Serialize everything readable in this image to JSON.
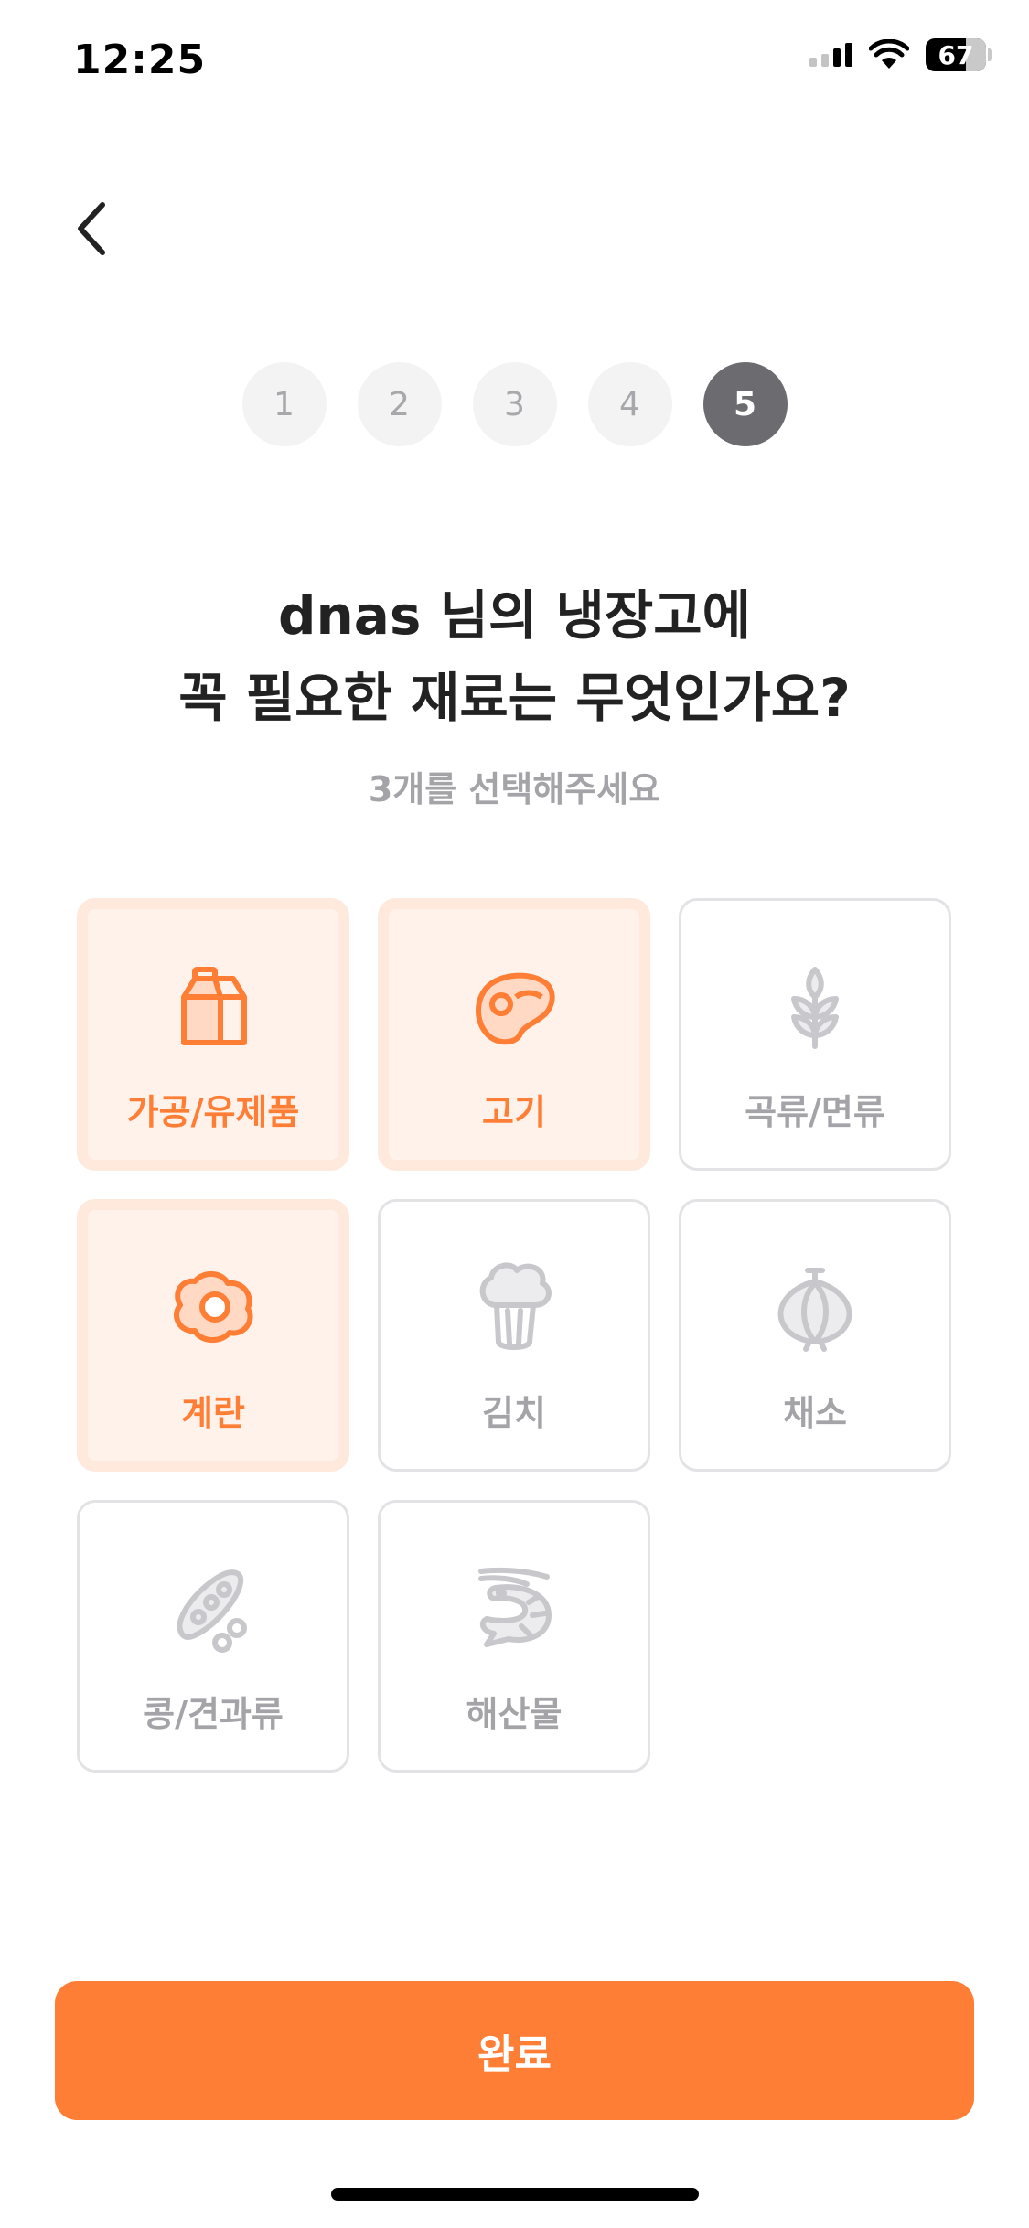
{
  "status_bar": {
    "time": "12:25",
    "battery": "67"
  },
  "steps": [
    "1",
    "2",
    "3",
    "4",
    "5"
  ],
  "current_step": "5",
  "title": {
    "line1": "dnas 님의 냉장고에",
    "line2": "꼭 필요한 재료는 무엇인가요?"
  },
  "subtitle": "3개를 선택해주세요",
  "categories": [
    {
      "label": "가공/유제품",
      "icon": "milk-carton-icon",
      "selected": true
    },
    {
      "label": "고기",
      "icon": "steak-icon",
      "selected": true
    },
    {
      "label": "곡류/면류",
      "icon": "wheat-icon",
      "selected": false
    },
    {
      "label": "계란",
      "icon": "fried-egg-icon",
      "selected": true
    },
    {
      "label": "김치",
      "icon": "cabbage-icon",
      "selected": false
    },
    {
      "label": "채소",
      "icon": "onion-icon",
      "selected": false
    },
    {
      "label": "콩/견과류",
      "icon": "pea-pod-icon",
      "selected": false
    },
    {
      "label": "해산물",
      "icon": "shrimp-icon",
      "selected": false
    }
  ],
  "complete_label": "완료",
  "colors": {
    "accent": "#ff7e35",
    "selected_bg": "#fff2eb",
    "inactive": "#c8c8cc"
  }
}
